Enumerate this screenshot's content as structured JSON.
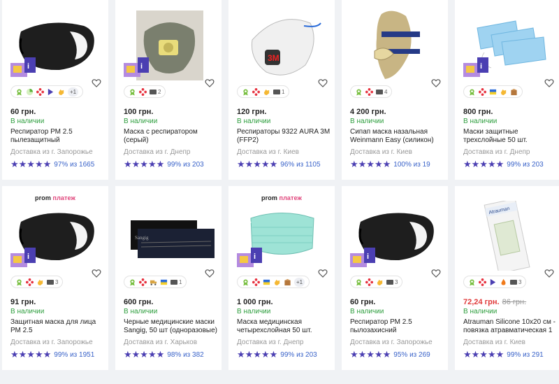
{
  "promo": {
    "brand": "prom",
    "pay": "платеж"
  },
  "stars": "★★★★★",
  "products": [
    {
      "price": "60 грн.",
      "stock": "В наличии",
      "title": "Респиратор РМ 2.5 пылезащитный",
      "delivery": "Доставка из г. Запорожье",
      "rating": "97% из 1665",
      "promo": false,
      "image": "black-mask-icon",
      "icons": [
        "award",
        "pie",
        "dots",
        "flag",
        "hand"
      ],
      "photo_count": "",
      "plus": "+1",
      "old_price": "",
      "badge": true
    },
    {
      "price": "100 грн.",
      "stock": "В наличии",
      "title": "Маска с респиратором (серый)",
      "delivery": "Доставка из г. Днепр",
      "rating": "99% из 203",
      "promo": false,
      "image": "grey-respirator-icon",
      "icons": [
        "award",
        "dots"
      ],
      "photo_count": "2",
      "plus": "",
      "old_price": "",
      "badge": true
    },
    {
      "price": "120 грн.",
      "stock": "В наличии",
      "title": "Респираторы 9322 AURA 3M (FFP2)",
      "delivery": "Доставка из г. Киев",
      "rating": "96% из 1105",
      "promo": false,
      "image": "white-3m-respirator-icon",
      "icons": [
        "award",
        "dots",
        "hand"
      ],
      "photo_count": "1",
      "plus": "",
      "old_price": "",
      "badge": false
    },
    {
      "price": "4 200 грн.",
      "stock": "В наличии",
      "title": "Сипап маска назальная Weinmann Easy (силикон)",
      "delivery": "Доставка из г. Киев",
      "rating": "100% из 19",
      "promo": false,
      "image": "cpap-mask-icon",
      "icons": [
        "award",
        "dots"
      ],
      "photo_count": "4",
      "plus": "",
      "old_price": "",
      "badge": false
    },
    {
      "price": "800 грн.",
      "stock": "В наличии",
      "title": "Маски защитные трехслойные 50 шт.",
      "delivery": "Доставка из г. Днепр",
      "rating": "99% из 203",
      "promo": false,
      "image": "blue-masks-icon",
      "icons": [
        "award",
        "dots",
        "ua",
        "hand",
        "box"
      ],
      "photo_count": "",
      "plus": "",
      "old_price": "",
      "badge": true
    },
    {
      "price": "91 грн.",
      "stock": "В наличии",
      "title": "Защитная маска для лица РМ 2.5",
      "delivery": "Доставка из г. Запорожье",
      "rating": "99% из 1951",
      "promo": true,
      "image": "black-mask-icon",
      "icons": [
        "award",
        "dots",
        "hand"
      ],
      "photo_count": "3",
      "plus": "",
      "old_price": "",
      "badge": true
    },
    {
      "price": "600 грн.",
      "stock": "В наличии",
      "title": "Черные медицинские маски Sangig, 50 шт (одноразовые)",
      "delivery": "Доставка из г. Харьков",
      "rating": "98% из 382",
      "promo": false,
      "image": "black-box-icon",
      "icons": [
        "award",
        "dots",
        "truck",
        "ua"
      ],
      "photo_count": "1",
      "plus": "",
      "old_price": "",
      "badge": false
    },
    {
      "price": "1 000 грн.",
      "stock": "В наличии",
      "title": "Маска медицинская четырехслойная 50 шт.",
      "delivery": "Доставка из г. Днепр",
      "rating": "99% из 203",
      "promo": true,
      "image": "green-mask-icon",
      "icons": [
        "award",
        "dots",
        "ua",
        "hand",
        "box"
      ],
      "photo_count": "",
      "plus": "+1",
      "old_price": "",
      "badge": true
    },
    {
      "price": "60 грн.",
      "stock": "В наличии",
      "title": "Респиратор РМ 2.5 пылозахисний",
      "delivery": "Доставка из г. Запорожье",
      "rating": "95% из 269",
      "promo": false,
      "image": "black-mask-icon",
      "icons": [
        "award",
        "dots",
        "hand"
      ],
      "photo_count": "3",
      "plus": "",
      "old_price": "",
      "badge": true
    },
    {
      "price": "72,24 грн.",
      "stock": "В наличии",
      "title": "Atrauman Silicone 10x20 см - повязка атравматическая 1",
      "delivery": "Доставка из г. Киев",
      "rating": "99% из 291",
      "promo": false,
      "image": "atrauman-box-icon",
      "icons": [
        "award",
        "dots",
        "flag",
        "fire"
      ],
      "photo_count": "3",
      "plus": "",
      "old_price": "86 грн.",
      "badge": false
    }
  ]
}
